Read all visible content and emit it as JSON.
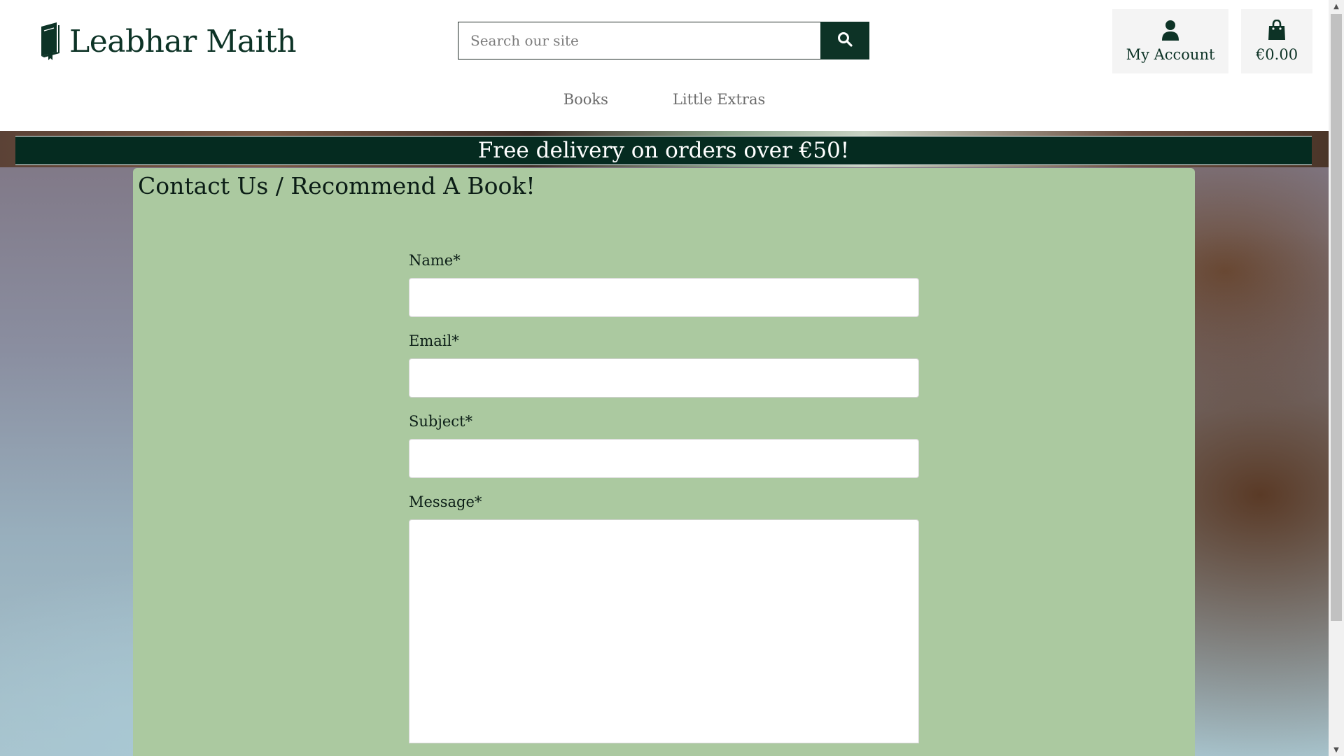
{
  "header": {
    "brand": "Leabhar Maith",
    "search": {
      "placeholder": "Search our site"
    },
    "account_label": "My Account",
    "cart_total": "€0.00"
  },
  "nav": {
    "items": [
      {
        "label": "Books"
      },
      {
        "label": "Little Extras"
      }
    ]
  },
  "banner": {
    "text": "Free delivery on orders over €50!"
  },
  "page": {
    "title": "Contact Us / Recommend A Book!",
    "form": {
      "name_label": "Name*",
      "email_label": "Email*",
      "subject_label": "Subject*",
      "message_label": "Message*"
    }
  },
  "icons": {
    "logo": "book-icon",
    "search": "search-icon",
    "account": "user-icon",
    "cart": "shopping-bag-icon"
  },
  "colors": {
    "brand_dark_green": "#0d3326",
    "banner_bg": "#052b20",
    "card_bg": "#abc9a0"
  }
}
